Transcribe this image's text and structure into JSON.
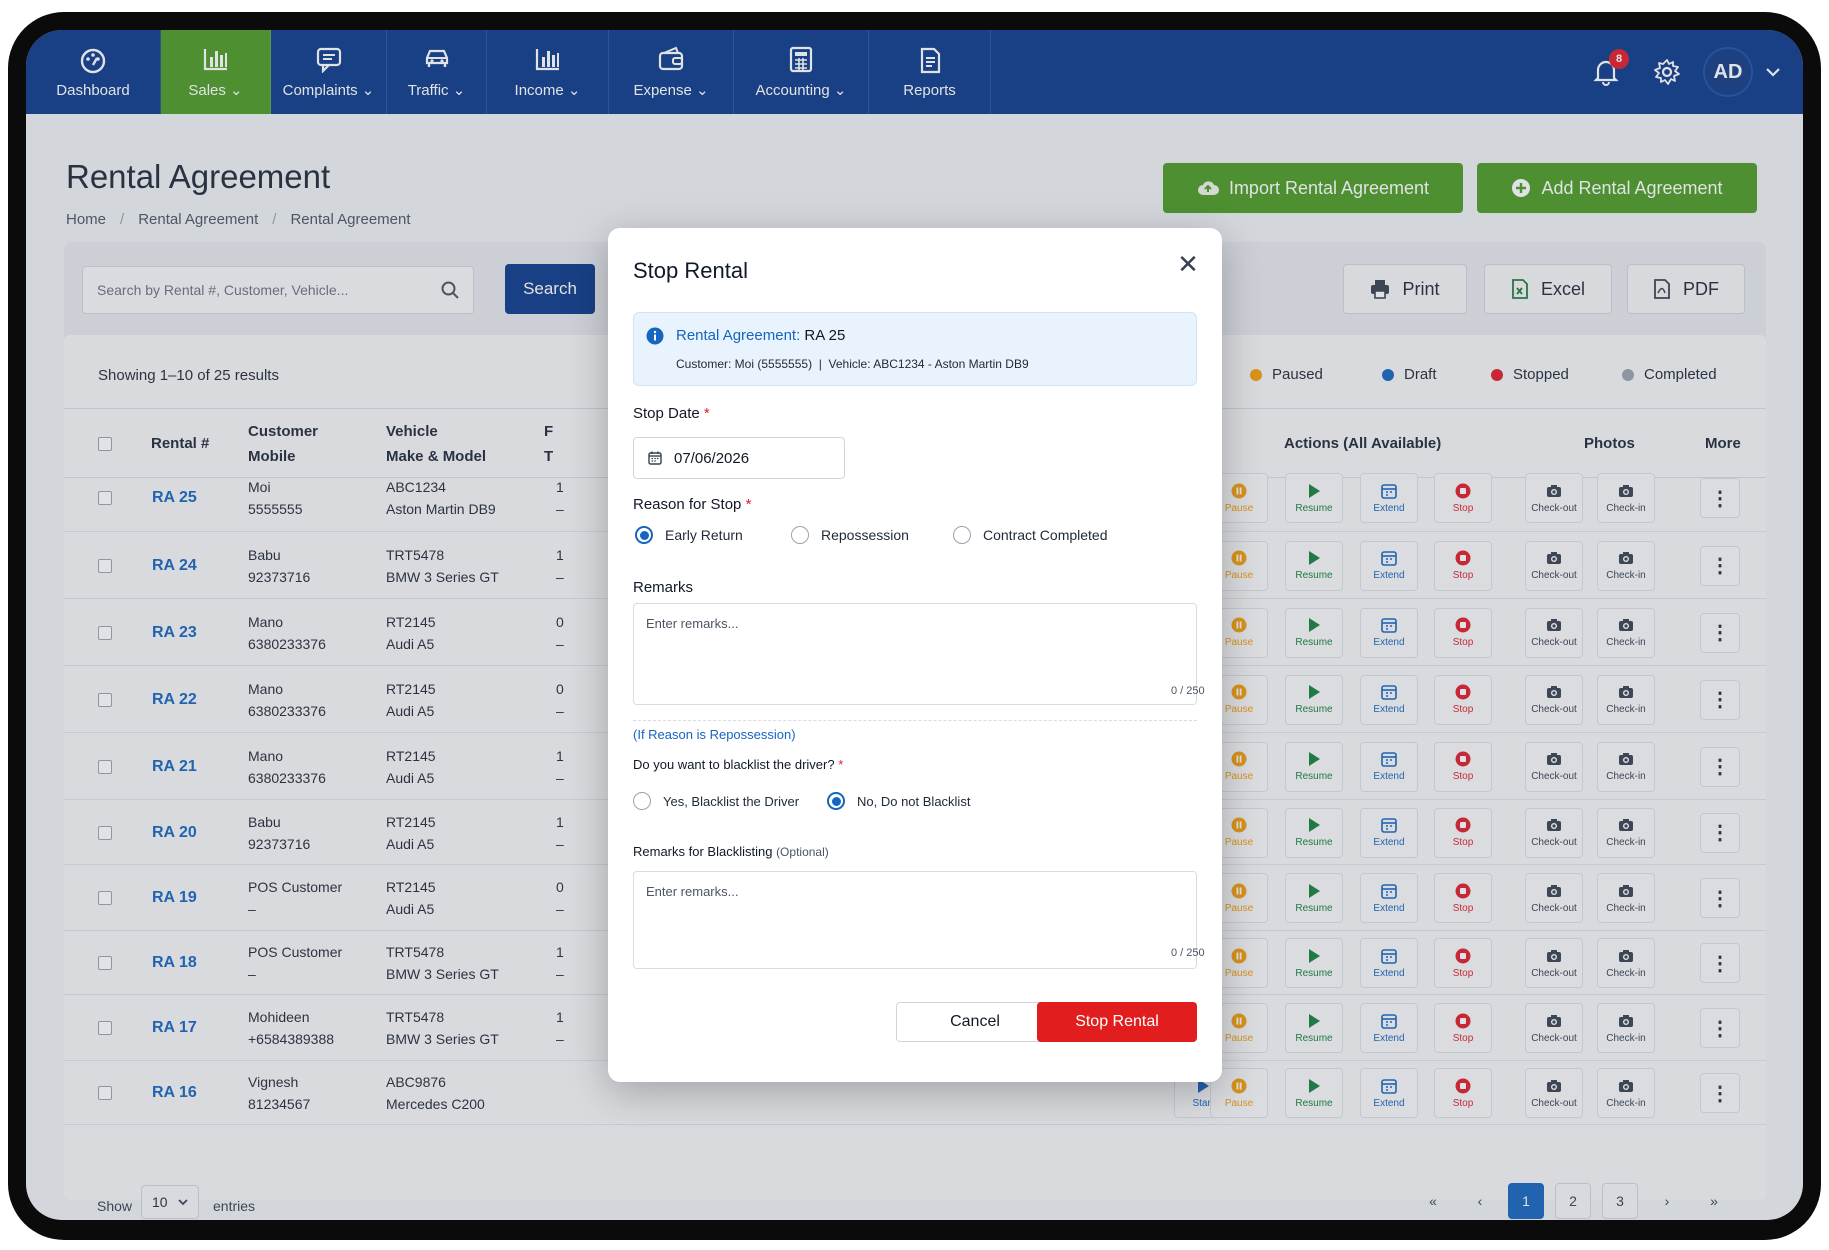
{
  "nav": {
    "items": [
      {
        "label": "Dashboard",
        "icon": "dashboard-icon"
      },
      {
        "label": "Sales ⌄",
        "icon": "bar-chart-icon",
        "active": true
      },
      {
        "label": "Complaints ⌄",
        "icon": "message-icon"
      },
      {
        "label": "Traffic ⌄",
        "icon": "car-icon"
      },
      {
        "label": "Income ⌄",
        "icon": "bar-chart-icon"
      },
      {
        "label": "Expense ⌄",
        "icon": "wallet-icon"
      },
      {
        "label": "Accounting ⌄",
        "icon": "calculator-icon"
      },
      {
        "label": "Reports",
        "icon": "document-icon"
      }
    ],
    "notification_count": "8",
    "avatar": "AD"
  },
  "header": {
    "title": "Rental Agreement",
    "breadcrumb": [
      "Home",
      "Rental Agreement",
      "Rental Agreement"
    ],
    "import_label": "Import Rental Agreement",
    "add_label": "Add Rental Agreement"
  },
  "toolbar": {
    "search_placeholder": "Search by Rental #, Customer, Vehicle...",
    "search_label": "Search",
    "print_label": "Print",
    "excel_label": "Excel",
    "pdf_label": "PDF"
  },
  "table": {
    "showing": "Showing 1–10 of 25 results",
    "legend": [
      {
        "label": "Paused",
        "color": "#f59e0b"
      },
      {
        "label": "Draft",
        "color": "#1665c0"
      },
      {
        "label": "Stopped",
        "color": "#e11d2a"
      },
      {
        "label": "Completed",
        "color": "#9ca3af"
      }
    ],
    "headers": {
      "rental": "Rental #",
      "customer_1": "Customer",
      "customer_2": "Mobile",
      "vehicle_1": "Vehicle",
      "vehicle_2": "Make & Model",
      "col4": "F",
      "col4b": "T",
      "actions": "Actions (All Available)",
      "photos": "Photos",
      "more": "More"
    },
    "action_labels": {
      "start": "Start",
      "pause": "Pause",
      "resume": "Resume",
      "extend": "Extend",
      "stop": "Stop",
      "checkout": "Check-out",
      "checkin": "Check-in"
    },
    "rows": [
      {
        "id": "RA 25",
        "customer": "Moi",
        "mobile": "5555555",
        "plate": "ABC1234",
        "model": "Aston Martin DB9",
        "c4a": "1",
        "c4b": "–"
      },
      {
        "id": "RA 24",
        "customer": "Babu",
        "mobile": "92373716",
        "plate": "TRT5478",
        "model": "BMW 3 Series GT",
        "c4a": "1",
        "c4b": "–"
      },
      {
        "id": "RA 23",
        "customer": "Mano",
        "mobile": "6380233376",
        "plate": "RT2145",
        "model": "Audi A5",
        "c4a": "0",
        "c4b": "–"
      },
      {
        "id": "RA 22",
        "customer": "Mano",
        "mobile": "6380233376",
        "plate": "RT2145",
        "model": "Audi A5",
        "c4a": "0",
        "c4b": "–"
      },
      {
        "id": "RA 21",
        "customer": "Mano",
        "mobile": "6380233376",
        "plate": "RT2145",
        "model": "Audi A5",
        "c4a": "1",
        "c4b": "–"
      },
      {
        "id": "RA 20",
        "customer": "Babu",
        "mobile": "92373716",
        "plate": "RT2145",
        "model": "Audi A5",
        "c4a": "1",
        "c4b": "–"
      },
      {
        "id": "RA 19",
        "customer": "POS Customer",
        "mobile": "–",
        "plate": "RT2145",
        "model": "Audi A5",
        "c4a": "0",
        "c4b": "–"
      },
      {
        "id": "RA 18",
        "customer": "POS Customer",
        "mobile": "–",
        "plate": "TRT5478",
        "model": "BMW 3 Series GT",
        "c4a": "1",
        "c4b": "–"
      },
      {
        "id": "RA 17",
        "customer": "Mohideen",
        "mobile": "+6584389388",
        "plate": "TRT5478",
        "model": "BMW 3 Series GT",
        "c4a": "1",
        "c4b": "–"
      },
      {
        "id": "RA 16",
        "customer": "Vignesh",
        "mobile": "81234567",
        "plate": "ABC9876",
        "model": "Mercedes C200",
        "c4a": "",
        "c4b": ""
      }
    ]
  },
  "footer": {
    "show": "Show",
    "entries_value": "10",
    "entries": "entries",
    "pages": [
      "«",
      "‹",
      "1",
      "2",
      "3",
      "›",
      "»"
    ]
  },
  "modal": {
    "title": "Stop Rental",
    "agreement_label": "Rental Agreement:",
    "agreement_value": "RA 25",
    "customer_line": "Customer: Moi (5555555)  |  Vehicle: ABC1234 - Aston Martin DB9",
    "stop_date_label": "Stop Date",
    "stop_date_value": "07/06/2026",
    "reason_label": "Reason for Stop",
    "reasons": [
      "Early Return",
      "Repossession",
      "Contract Completed"
    ],
    "remarks_label": "Remarks",
    "remarks_placeholder": "Enter remarks...",
    "remarks_count": "0 / 250",
    "repossession_note": "(If Reason is Repossession)",
    "blacklist_question": "Do you want to blacklist the driver?",
    "blacklist_options": [
      "Yes, Blacklist the Driver",
      "No, Do not Blacklist"
    ],
    "blacklist_remarks_label": "Remarks for Blacklisting",
    "blacklist_remarks_optional": "(Optional)",
    "blacklist_placeholder": "Enter remarks...",
    "blacklist_count": "0 / 250",
    "cancel_label": "Cancel",
    "stop_label": "Stop Rental",
    "required_mark": "*"
  },
  "colors": {
    "nav": "#0c3a8a",
    "accent_green": "#4b9a25",
    "link": "#1665c0",
    "danger": "#e11d1d"
  }
}
